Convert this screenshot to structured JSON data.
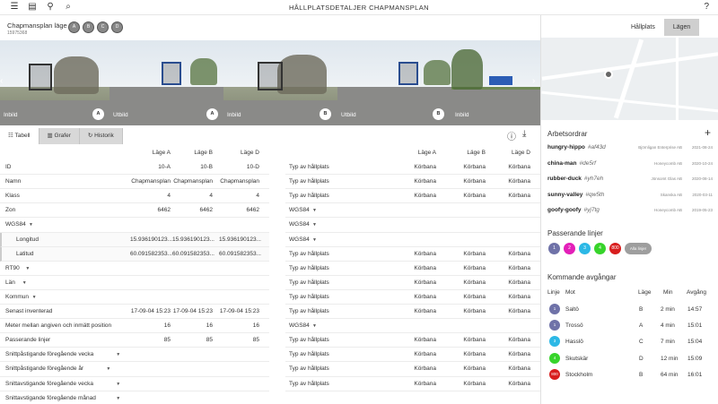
{
  "topbar": {
    "title": "HÅLLPLATSDETALJER CHAPMANSPLAN"
  },
  "header": {
    "name": "Chapmansplan läge",
    "id": "15975368",
    "chips": [
      "A",
      "B",
      "C",
      "D"
    ]
  },
  "gallery": {
    "photos": [
      {
        "caption": "Inbild",
        "badge": "A"
      },
      {
        "caption": "Utbild",
        "badge": "A"
      },
      {
        "caption": "Inbild",
        "badge": "B"
      },
      {
        "caption": "Utbild",
        "badge": "B"
      },
      {
        "caption": "Inbild",
        "badge": ""
      }
    ]
  },
  "tabs": [
    {
      "label": "Tabell",
      "icon": "table-icon"
    },
    {
      "label": "Grafer",
      "icon": "chart-icon"
    },
    {
      "label": "Historik",
      "icon": "history-icon"
    }
  ],
  "left_table": {
    "columns": [
      "Läge A",
      "Läge B",
      "Läge D"
    ],
    "rows": [
      {
        "label": "ID",
        "values": [
          "10-A",
          "10-B",
          "10-D"
        ]
      },
      {
        "label": "Namn",
        "values": [
          "Chapmansplan",
          "Chapmansplan",
          "Chapmansplan"
        ]
      },
      {
        "label": "Klass",
        "values": [
          "4",
          "4",
          "4"
        ]
      },
      {
        "label": "Zon",
        "values": [
          "6462",
          "6462",
          "6462"
        ]
      },
      {
        "label": "WGS84",
        "values": [
          "",
          "",
          ""
        ],
        "expand": true
      },
      {
        "label": "Longitud",
        "values": [
          "15.936190123...",
          "15.936190123...",
          "15.936190123..."
        ],
        "sub": true
      },
      {
        "label": "Latitud",
        "values": [
          "60.091582353...",
          "60.091582353...",
          "60.091582353..."
        ],
        "sub": true
      },
      {
        "label": "RT90",
        "values": [
          "",
          "",
          ""
        ],
        "expand": true
      },
      {
        "label": "Län",
        "values": [
          "",
          "",
          ""
        ],
        "expand": true
      },
      {
        "label": "Kommun",
        "values": [
          "",
          "",
          ""
        ],
        "expand": true
      },
      {
        "label": "Senast inventerad",
        "values": [
          "17-09-04 15:23",
          "17-09-04 15:23",
          "17-09-04 15:23"
        ]
      },
      {
        "label": "Meter mellan angiven och inmätt position",
        "values": [
          "16",
          "16",
          "16"
        ]
      },
      {
        "label": "Passerande linjer",
        "values": [
          "85",
          "85",
          "85"
        ]
      },
      {
        "label": "Snittpåstigande föregående vecka",
        "values": [
          "",
          "",
          ""
        ],
        "expand": true
      },
      {
        "label": "Snittpåstigande föregående år",
        "values": [
          "",
          "",
          ""
        ],
        "expand": true
      },
      {
        "label": "Snittavstigande föregående vecka",
        "values": [
          "",
          "",
          ""
        ],
        "expand": true
      },
      {
        "label": "Snittavstigande föregående månad",
        "values": [
          "",
          "",
          ""
        ],
        "expand": true
      }
    ]
  },
  "right_table": {
    "columns": [
      "Läge A",
      "Läge B",
      "Läge D"
    ],
    "rows": [
      {
        "label": "Typ av hållplats",
        "values": [
          "Körbana",
          "Körbana",
          "Körbana"
        ]
      },
      {
        "label": "Typ av hållplats",
        "values": [
          "Körbana",
          "Körbana",
          "Körbana"
        ]
      },
      {
        "label": "Typ av hållplats",
        "values": [
          "Körbana",
          "Körbana",
          "Körbana"
        ]
      },
      {
        "label": "WGS84",
        "values": [
          "",
          "",
          ""
        ],
        "expand": true
      },
      {
        "label": "WGS84",
        "values": [
          "",
          "",
          ""
        ],
        "expand": true
      },
      {
        "label": "WGS84",
        "values": [
          "",
          "",
          ""
        ],
        "expand": true
      },
      {
        "label": "Typ av hållplats",
        "values": [
          "Körbana",
          "Körbana",
          "Körbana"
        ]
      },
      {
        "label": "Typ av hållplats",
        "values": [
          "Körbana",
          "Körbana",
          "Körbana"
        ]
      },
      {
        "label": "Typ av hållplats",
        "values": [
          "Körbana",
          "Körbana",
          "Körbana"
        ]
      },
      {
        "label": "Typ av hållplats",
        "values": [
          "Körbana",
          "Körbana",
          "Körbana"
        ]
      },
      {
        "label": "Typ av hållplats",
        "values": [
          "Körbana",
          "Körbana",
          "Körbana"
        ]
      },
      {
        "label": "WGS84",
        "values": [
          "",
          "",
          ""
        ],
        "expand": true
      },
      {
        "label": "Typ av hållplats",
        "values": [
          "Körbana",
          "Körbana",
          "Körbana"
        ]
      },
      {
        "label": "Typ av hållplats",
        "values": [
          "Körbana",
          "Körbana",
          "Körbana"
        ]
      },
      {
        "label": "Typ av hållplats",
        "values": [
          "Körbana",
          "Körbana",
          "Körbana"
        ]
      },
      {
        "label": "Typ av hållplats",
        "values": [
          "Körbana",
          "Körbana",
          "Körbana"
        ]
      }
    ]
  },
  "sidebar": {
    "segments": [
      "Hållplats",
      "Lägen"
    ],
    "workorders_title": "Arbetsordrar",
    "workorders": [
      {
        "name": "hungry-hippo",
        "hash": "#af43d",
        "company": "Björnligan Enterprise AB",
        "date": "2021-08-24"
      },
      {
        "name": "china-man",
        "hash": "#de5rf",
        "company": "Honeycomb AB",
        "date": "2020-10-24"
      },
      {
        "name": "rubber-duck",
        "hash": "#yh7eh",
        "company": "Jönsomt Glas AB",
        "date": "2020-08-14"
      },
      {
        "name": "sunny-valley",
        "hash": "#qw5th",
        "company": "Skanska AB",
        "date": "2020-03-11"
      },
      {
        "name": "goofy-goofy",
        "hash": "#yj7tg",
        "company": "Honeycomb AB",
        "date": "2019-05-23"
      }
    ],
    "lines_title": "Passerande linjer",
    "lines": [
      {
        "label": "1",
        "color": "#6f72a8"
      },
      {
        "label": "2",
        "color": "#e31fb8"
      },
      {
        "label": "3",
        "color": "#2cb8e6"
      },
      {
        "label": "4",
        "color": "#37d42b"
      },
      {
        "label": "800",
        "color": "#d81e1e"
      },
      {
        "label": "Alla linjer",
        "color": "#9e9e9e"
      }
    ],
    "departures_title": "Kommande avgångar",
    "departures_head": {
      "line": "Linje",
      "to": "Mot",
      "stop": "Läge",
      "min": "Min",
      "dep": "Avgång"
    },
    "departures": [
      {
        "line": "1",
        "color": "#6f72a8",
        "to": "Saltö",
        "stop": "B",
        "min": "2 min",
        "dep": "14:57"
      },
      {
        "line": "1",
        "color": "#6f72a8",
        "to": "Trossö",
        "stop": "A",
        "min": "4 min",
        "dep": "15:01"
      },
      {
        "line": "3",
        "color": "#2cb8e6",
        "to": "Hasslö",
        "stop": "C",
        "min": "7 min",
        "dep": "15:04"
      },
      {
        "line": "4",
        "color": "#37d42b",
        "to": "Skutskär",
        "stop": "D",
        "min": "12 min",
        "dep": "15:09"
      },
      {
        "line": "800",
        "color": "#d81e1e",
        "to": "Stockholm",
        "stop": "B",
        "min": "64 min",
        "dep": "16:01"
      }
    ]
  }
}
